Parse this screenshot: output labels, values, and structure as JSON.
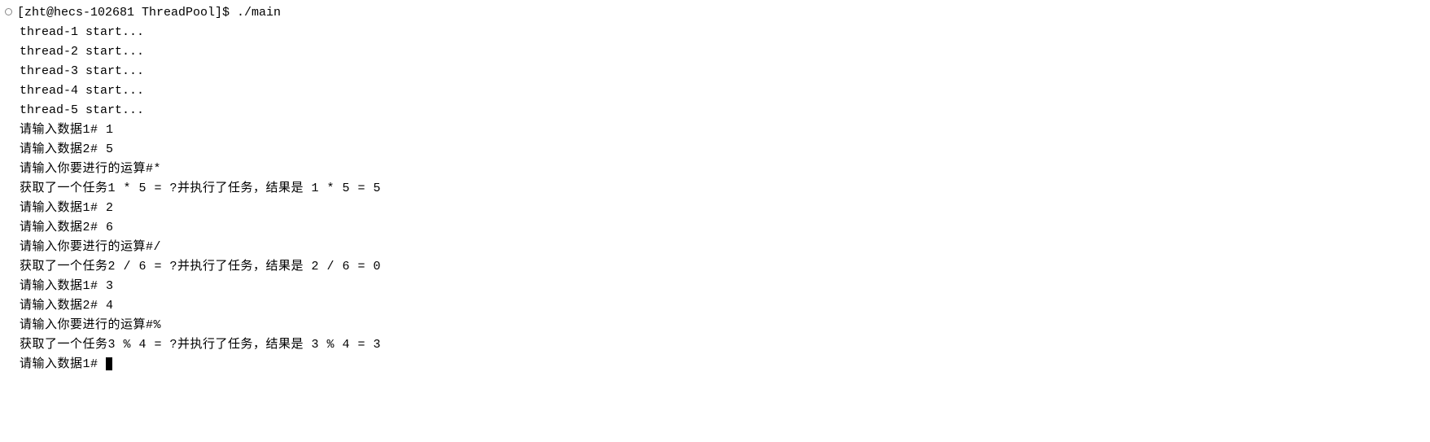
{
  "prompt": "[zht@hecs-102681 ThreadPool]$ ./main",
  "lines": [
    "thread-1 start...",
    "thread-2 start...",
    "thread-3 start...",
    "thread-4 start...",
    "thread-5 start...",
    "请输入数据1# 1",
    "请输入数据2# 5",
    "请输入你要进行的运算#*",
    "获取了一个任务1 * 5 = ?并执行了任务，结果是 1 * 5 = 5",
    "请输入数据1# 2",
    "请输入数据2# 6",
    "请输入你要进行的运算#/",
    "获取了一个任务2 / 6 = ?并执行了任务，结果是 2 / 6 = 0",
    "请输入数据1# 3",
    "请输入数据2# 4",
    "请输入你要进行的运算#%",
    "获取了一个任务3 % 4 = ?并执行了任务，结果是 3 % 4 = 3",
    "请输入数据1# "
  ]
}
